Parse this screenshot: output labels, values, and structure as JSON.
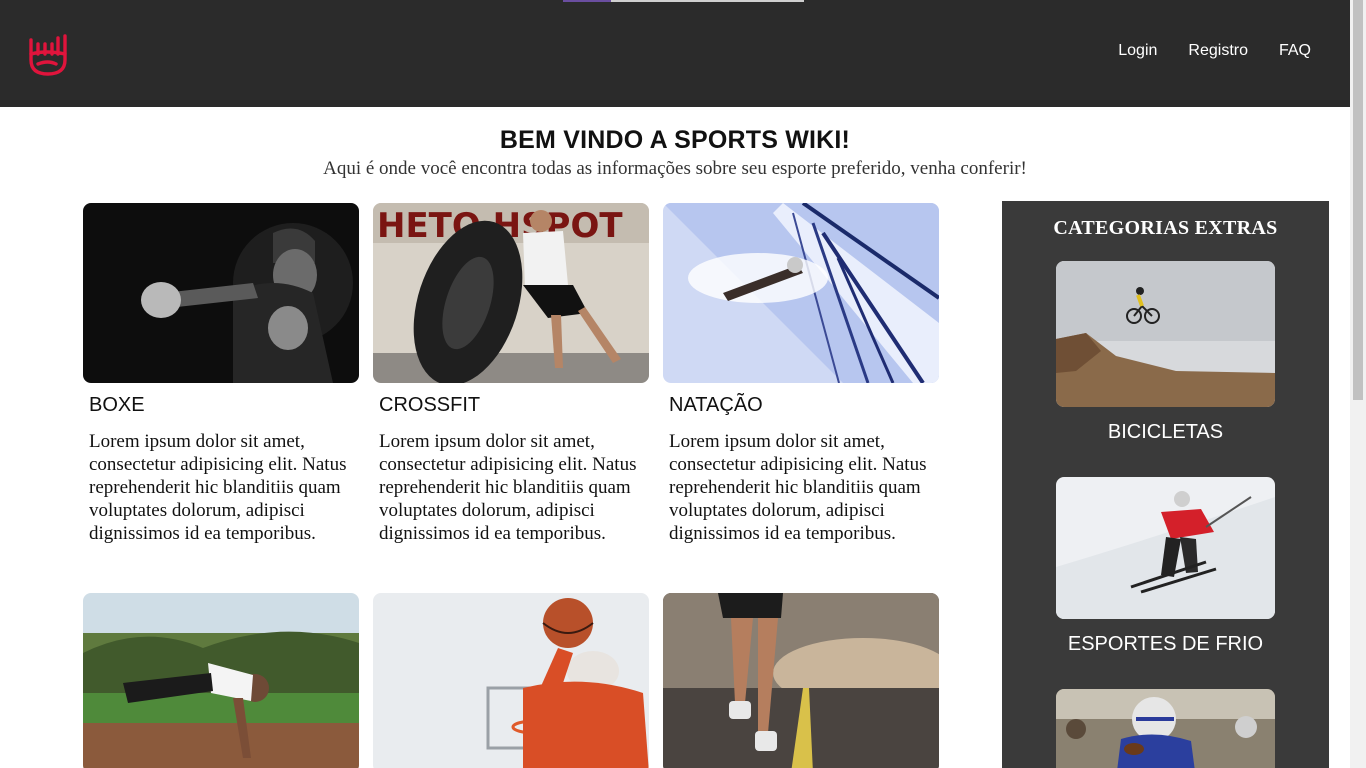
{
  "header": {
    "logo_icon": "rock-hand-icon",
    "logo_color": "#e0143c",
    "nav": [
      {
        "label": "Login"
      },
      {
        "label": "Registro"
      },
      {
        "label": "FAQ"
      }
    ]
  },
  "hero": {
    "title": "BEM VINDO A SPORTS WIKI!",
    "subtitle": "Aqui é onde você encontra todas as informações sobre seu esporte preferido, venha conferir!"
  },
  "cards": [
    {
      "title": "BOXE",
      "text": "Lorem ipsum dolor sit amet, consectetur adipisicing elit. Natus reprehenderit hic blanditiis quam voluptates dolorum, adipisci dignissimos id ea temporibus."
    },
    {
      "title": "CROSSFIT",
      "text": "Lorem ipsum dolor sit amet, consectetur adipisicing elit. Natus reprehenderit hic blanditiis quam voluptates dolorum, adipisci dignissimos id ea temporibus."
    },
    {
      "title": "NATAÇÃO",
      "text": "Lorem ipsum dolor sit amet, consectetur adipisicing elit. Natus reprehenderit hic blanditiis quam voluptates dolorum, adipisci dignissimos id ea temporibus."
    }
  ],
  "sidebar": {
    "title": "CATEGORIAS EXTRAS",
    "items": [
      {
        "label": "BICICLETAS"
      },
      {
        "label": "ESPORTES DE FRIO"
      }
    ]
  },
  "colors": {
    "header_bg": "#2b2b2b",
    "sidebar_bg": "#3a3a3a"
  }
}
